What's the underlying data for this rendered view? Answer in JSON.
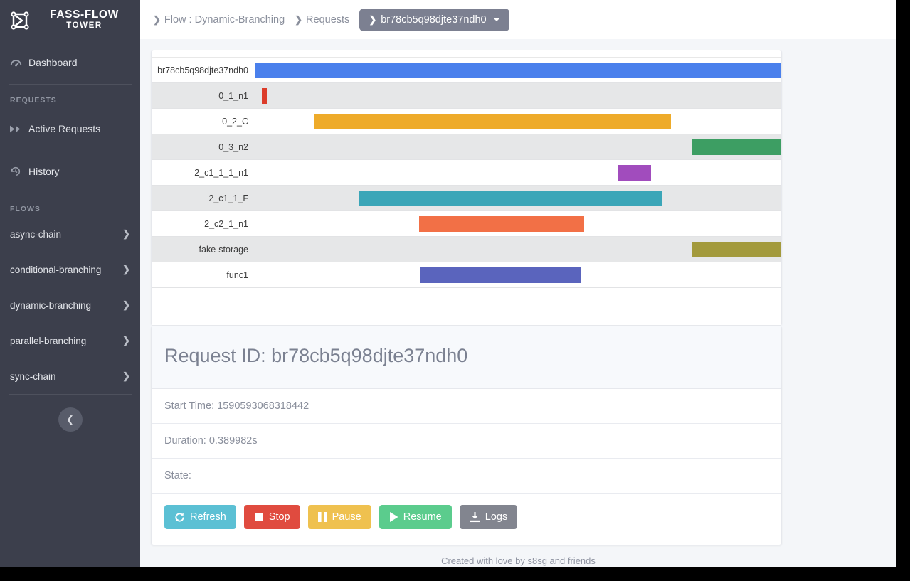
{
  "sidebar": {
    "brand": {
      "title": "FASS-FLOW",
      "subtitle": "TOWER",
      "logo_icon": "graph-nodes-icon"
    },
    "nav": [
      {
        "label": "Dashboard",
        "icon": "dashboard-gauge-icon"
      }
    ],
    "sections": [
      {
        "label": "REQUESTS",
        "items": [
          {
            "label": "Active Requests",
            "icon": "fast-forward-icon"
          },
          {
            "label": "History",
            "icon": "clock-rewind-icon"
          }
        ]
      },
      {
        "label": "FLOWS",
        "items": [
          {
            "label": "async-chain",
            "icon": "chevron-right-icon"
          },
          {
            "label": "conditional-branching",
            "icon": "chevron-right-icon"
          },
          {
            "label": "dynamic-branching",
            "icon": "chevron-right-icon"
          },
          {
            "label": "parallel-branching",
            "icon": "chevron-right-icon"
          },
          {
            "label": "sync-chain",
            "icon": "chevron-right-icon"
          }
        ]
      }
    ],
    "collapse": {
      "icon": "chevron-left-icon"
    },
    "bg_color": "#3c3f4c"
  },
  "breadcrumb": {
    "items": [
      {
        "label": "Flow : Dynamic-Branching",
        "icon": "angle-right-icon"
      },
      {
        "label": "Requests",
        "icon": "angle-right-icon"
      }
    ],
    "active": {
      "label": "br78cb5q98djte37ndh0",
      "icon": "angle-right-icon",
      "caret": "caret-down-icon",
      "bg_color": "#7c8091"
    }
  },
  "chart_data": {
    "type": "bar",
    "title": "",
    "xlabel": "",
    "ylabel": "",
    "orientation": "horizontal",
    "note": "Gantt timeline of request spans; start/end expressed as percent of total request duration",
    "xlim": [
      0,
      100
    ],
    "grid": false,
    "legend": "none",
    "categories": [
      "br78cb5q98djte37ndh0",
      "0_1_n1",
      "0_2_C",
      "0_3_n2",
      "2_c1_1_1_n1",
      "2_c1_1_F",
      "2_c2_1_n1",
      "fake-storage",
      "func1"
    ],
    "bars": [
      {
        "label": "br78cb5q98djte37ndh0",
        "start": 0.0,
        "end": 100.0,
        "color": "#4a80ec"
      },
      {
        "label": "0_1_n1",
        "start": 1.2,
        "end": 2.2,
        "color": "#dc3c2a"
      },
      {
        "label": "0_2_C",
        "start": 11.1,
        "end": 79.0,
        "color": "#eeab2a"
      },
      {
        "label": "0_3_n2",
        "start": 83.0,
        "end": 100.0,
        "color": "#3d9e63"
      },
      {
        "label": "2_c1_1_1_n1",
        "start": 69.0,
        "end": 75.2,
        "color": "#a14cbd"
      },
      {
        "label": "2_c1_1_F",
        "start": 19.7,
        "end": 77.4,
        "color": "#3ba6b8"
      },
      {
        "label": "2_c2_1_n1",
        "start": 31.1,
        "end": 62.5,
        "color": "#f27046"
      },
      {
        "label": "fake-storage",
        "start": 83.0,
        "end": 100.0,
        "color": "#a39a3c"
      },
      {
        "label": "func1",
        "start": 31.4,
        "end": 62.0,
        "color": "#5a64bd"
      }
    ]
  },
  "details": {
    "title": "Request ID: br78cb5q98djte37ndh0",
    "rows": [
      "Start Time: 1590593068318442",
      "Duration: 0.389982s",
      "State:"
    ],
    "buttons": [
      {
        "label": "Refresh",
        "icon": "refresh-icon",
        "color": "#5bc0d4"
      },
      {
        "label": "Stop",
        "icon": "stop-square-icon",
        "color": "#e04b3f"
      },
      {
        "label": "Pause",
        "icon": "pause-icon",
        "color": "#efc14f"
      },
      {
        "label": "Resume",
        "icon": "play-icon",
        "color": "#5bcc8d"
      },
      {
        "label": "Logs",
        "icon": "download-icon",
        "color": "#82858f"
      }
    ]
  },
  "footer": {
    "text": "Created with love by s8sg and friends"
  }
}
